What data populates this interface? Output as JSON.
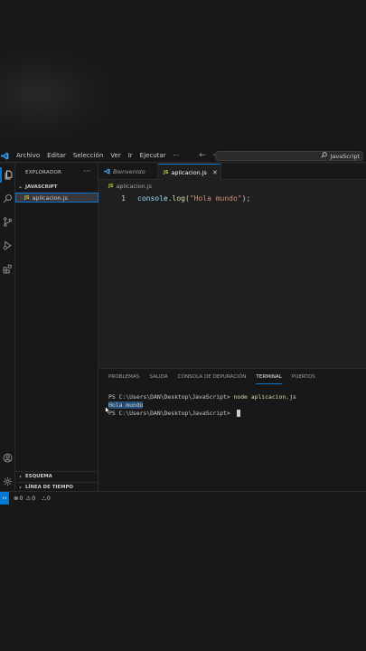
{
  "titlebar": {
    "menu": [
      "Archivo",
      "Editar",
      "Selección",
      "Ver",
      "Ir",
      "Ejecutar",
      "···"
    ],
    "search_label": "JavaScript"
  },
  "sidebar": {
    "header": "EXPLORADOR",
    "more": "···",
    "folder": "JAVASCRIPT",
    "file": "aplicacion.js",
    "outline": "ESQUEMA",
    "timeline": "LÍNEA DE TIEMPO"
  },
  "tabs": {
    "welcome": "Bienvenido",
    "active": "aplicacion.js",
    "close": "✕",
    "js_badge": "JS"
  },
  "breadcrumb": {
    "file": "aplicacion.js"
  },
  "editor": {
    "line_number": "1",
    "tokens": {
      "obj": "console",
      "dot": ".",
      "fn": "log",
      "open": "(",
      "str": "\"Hola mundo\"",
      "close": ");"
    }
  },
  "panel": {
    "tabs": [
      "PROBLEMAS",
      "SALIDA",
      "CONSOLA DE DEPURACIÓN",
      "TERMINAL",
      "PUERTOS"
    ],
    "active_tab": "TERMINAL",
    "prompt1": "PS C:\\Users\\DAN\\Desktop\\JavaScript> ",
    "command": "node aplicacion.js",
    "output": "Hola mundo",
    "prompt2": "PS C:\\Users\\DAN\\Desktop\\JavaScript> "
  },
  "statusbar": {
    "errors": "0",
    "warnings": "0",
    "ports": "0"
  },
  "colors": {
    "accent": "#0078d4",
    "js_badge": "#cbcb41",
    "string": "#ce9178"
  }
}
